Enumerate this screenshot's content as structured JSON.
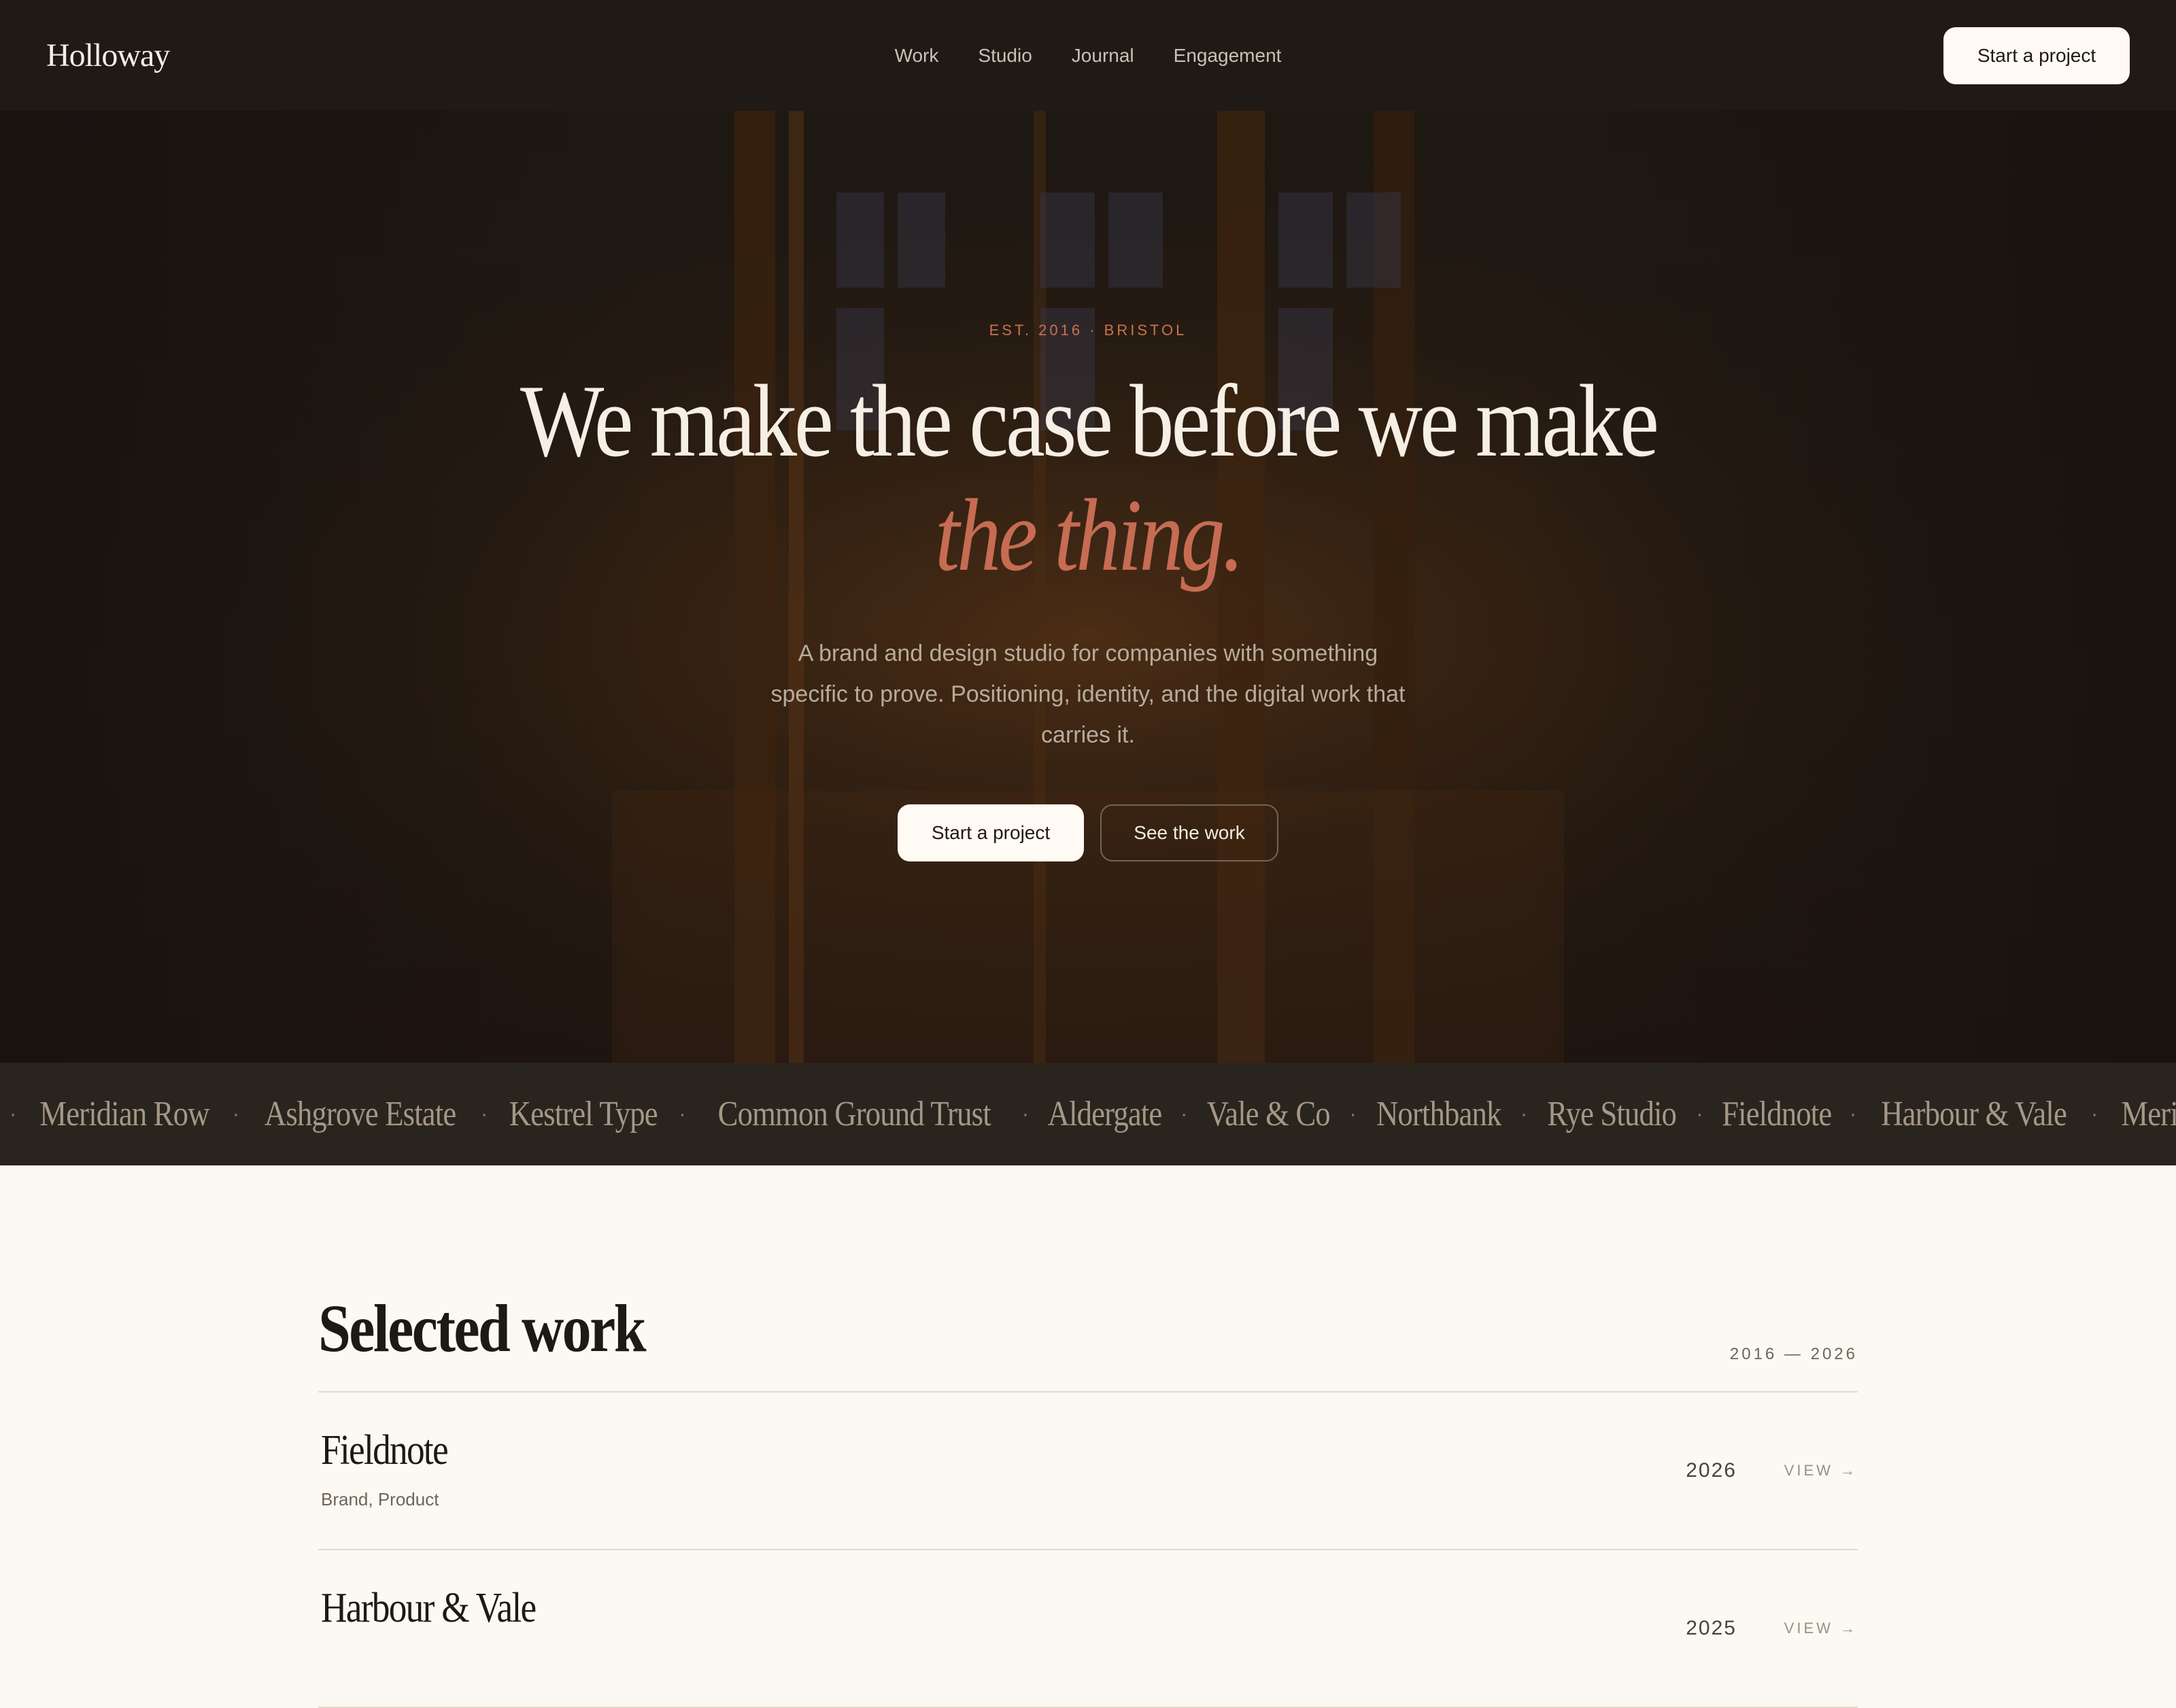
{
  "nav": {
    "logo": "Holloway",
    "links": [
      "Work",
      "Studio",
      "Journal",
      "Engagement"
    ],
    "cta": "Start a project"
  },
  "hero": {
    "eyebrow": "EST. 2016 · BRISTOL",
    "headline_line1": "We make the case before we make",
    "headline_accent": "the thing.",
    "subtitle": "A brand and design studio for companies with something specific to prove. Positioning, identity, and the digital work that carries it.",
    "primary_cta": "Start a project",
    "secondary_cta": "See the work",
    "accent_color": "#c66c52"
  },
  "clients": [
    "Meridian Row",
    "Ashgrove Estate",
    "Kestrel Type",
    "Common Ground Trust",
    "Aldergate",
    "Vale & Co",
    "Northbank",
    "Rye Studio",
    "Fieldnote",
    "Harbour & Vale",
    "Meridian Row"
  ],
  "work": {
    "title": "Selected work",
    "range": "2016 — 2026",
    "projects": [
      {
        "name": "Fieldnote",
        "tags": "Brand, Product",
        "year": "2026",
        "view": "VIEW →"
      },
      {
        "name": "Harbour & Vale",
        "tags": "",
        "year": "2025",
        "view": "VIEW →"
      }
    ]
  }
}
